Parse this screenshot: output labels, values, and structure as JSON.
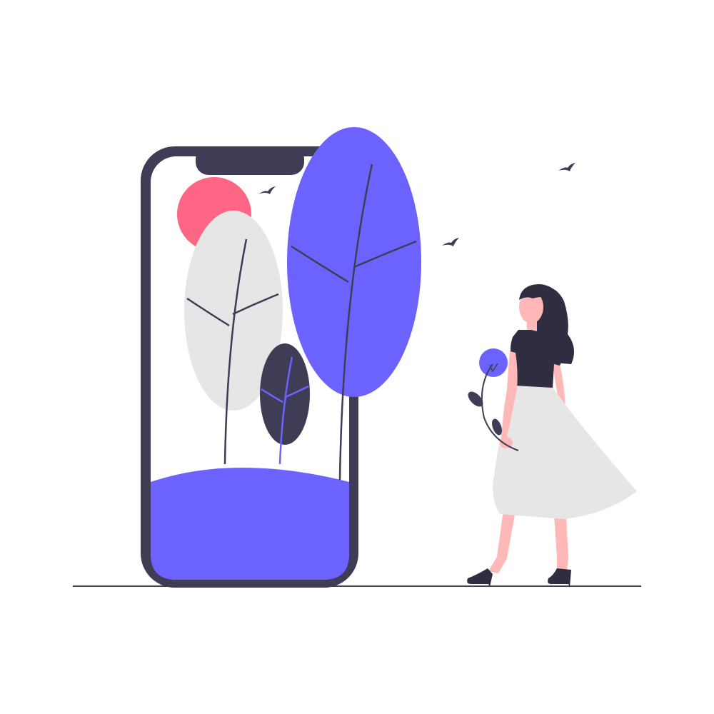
{
  "illustration": {
    "subject": "woman-looking-at-phone-with-trees",
    "palette": {
      "background": "#ffffff",
      "ink": "#3f3d56",
      "accent": "#6c63ff",
      "sun": "#ff6584",
      "light_gray": "#e6e6e6",
      "skin": "#ffb8b8",
      "hair": "#2f2e41",
      "phone_screen": "#ffffff"
    },
    "icons": [
      "smartphone-icon",
      "sun-icon",
      "tree-icon",
      "bird-icon",
      "flower-icon",
      "person-icon"
    ]
  }
}
